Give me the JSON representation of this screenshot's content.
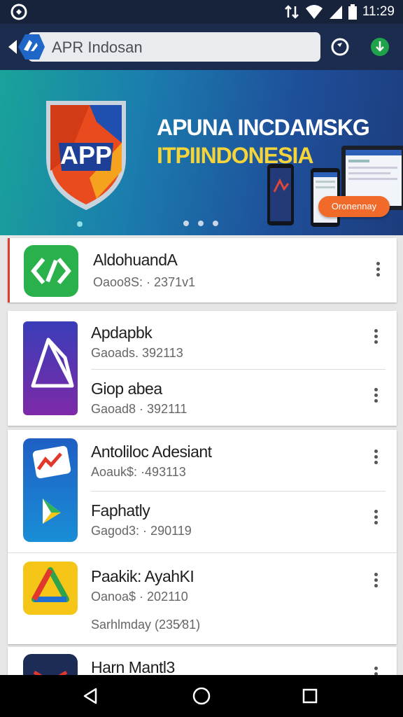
{
  "status_bar": {
    "time": "11:29",
    "icons": [
      "app-notification-icon",
      "data-transfer-icon",
      "wifi-icon",
      "signal-icon",
      "battery-icon"
    ]
  },
  "app_bar": {
    "search_text": "APR Indosan",
    "actions": [
      "refresh-icon",
      "download-icon"
    ]
  },
  "banner": {
    "logo_text": "APP",
    "title_line_1": "APUNA INCDAMSKG",
    "title_line_2": "ITPIINDONESIA",
    "cta_label": "Oronennay",
    "page_indicator": {
      "total": 4,
      "active": 1
    }
  },
  "app_list": [
    {
      "name": "AldohuandA",
      "meta": "Oaoo8S: · 2371v1",
      "icon": "link-app-icon",
      "accent": "#2bb14b"
    },
    {
      "name": "Apdapbk",
      "meta": "Gaoads. 392113",
      "icon": "triangle-app-icon",
      "accent": "#5b2fa3"
    },
    {
      "name": "Giop abea",
      "meta": "Gaoad8 · 392111",
      "icon": "triangle-app-icon",
      "accent": "#5b2fa3"
    },
    {
      "name": "Antoliloc Adesiant",
      "meta": "Aoauk$: ·493113",
      "icon": "chart-app-icon",
      "accent": "#1f6fd1"
    },
    {
      "name": "Faphatly",
      "meta": "Gagod3: · 290119",
      "icon": "play-app-icon",
      "accent": "#1f6fd1"
    },
    {
      "name": "Paakik: AyahKI",
      "meta": "Oanoa$ · 202110",
      "icon": "drive-app-icon",
      "accent": "#f5c518"
    },
    {
      "name": "Harn Mantl3",
      "icon": "mail-app-icon",
      "accent": "#1c2c57"
    }
  ],
  "extra_line": "Sarhlmday (235⁄81)"
}
